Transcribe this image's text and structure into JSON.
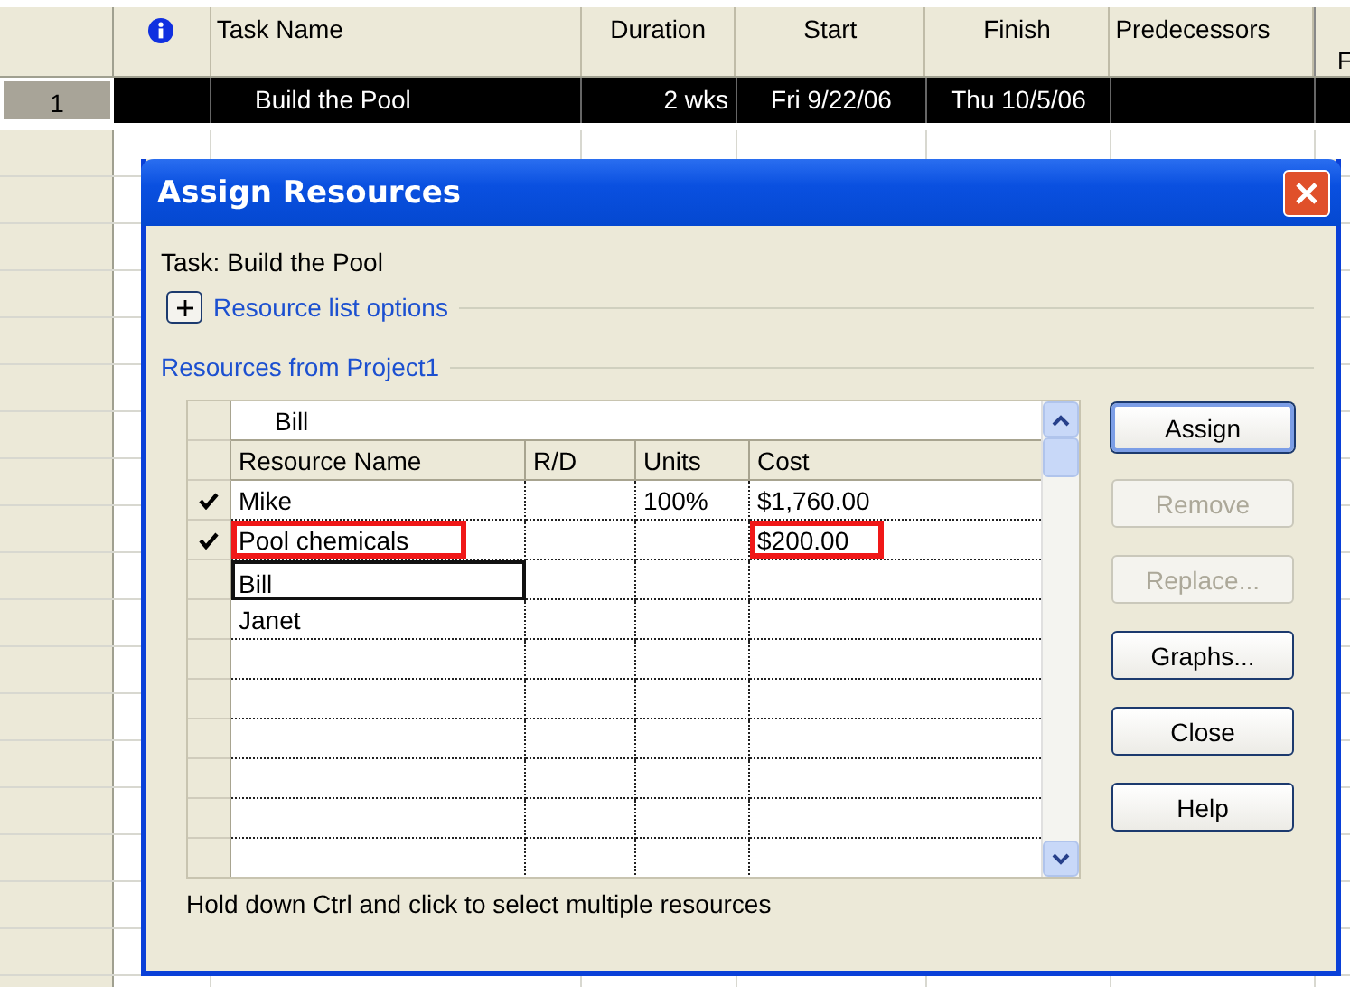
{
  "project": {
    "columns": [
      {
        "kind": "info"
      },
      {
        "kind": "text",
        "label": "Task Name"
      },
      {
        "kind": "num",
        "label": "Duration"
      },
      {
        "kind": "center",
        "label": "Start"
      },
      {
        "kind": "center",
        "label": "Finish"
      },
      {
        "kind": "text",
        "label": "Predecessors"
      }
    ],
    "timescale_fragment": "F",
    "rows": [
      {
        "number": "1",
        "task_name": "Build the Pool",
        "duration": "2 wks",
        "start": "Fri 9/22/06",
        "finish": "Thu 10/5/06",
        "selected": true
      }
    ]
  },
  "dialog": {
    "title": "Assign Resources",
    "task_label": "Task: Build the Pool",
    "options": {
      "label": "Resource list options",
      "expanded": false
    },
    "group_label": "Resources from Project1",
    "entry_value": "Bill",
    "columns": [
      "Resource Name",
      "R/D",
      "Units",
      "Cost"
    ],
    "rows": [
      {
        "checked": true,
        "name": "Mike",
        "units": "100%",
        "cost": "$1,760.00",
        "focused": false,
        "name_highlighted": false,
        "cost_highlighted": false
      },
      {
        "checked": true,
        "name": "Pool chemicals",
        "cost": "$200.00",
        "focused": false,
        "name_highlighted": true,
        "cost_highlighted": true
      },
      {
        "checked": false,
        "name": "Bill",
        "focused": true,
        "name_highlighted": false,
        "cost_highlighted": false
      },
      {
        "checked": false,
        "name": "Janet",
        "focused": false,
        "name_highlighted": false,
        "cost_highlighted": false
      }
    ],
    "buttons": [
      {
        "label": "Assign",
        "disabled": false,
        "default": true
      },
      {
        "label": "Remove",
        "disabled": true,
        "default": false
      },
      {
        "label": "Replace...",
        "disabled": true,
        "default": false
      },
      {
        "label": "Graphs...",
        "disabled": false,
        "default": false
      },
      {
        "label": "Close",
        "disabled": false,
        "default": false
      },
      {
        "label": "Help",
        "disabled": false,
        "default": false
      }
    ],
    "hint": "Hold down Ctrl and click to select multiple resources"
  }
}
